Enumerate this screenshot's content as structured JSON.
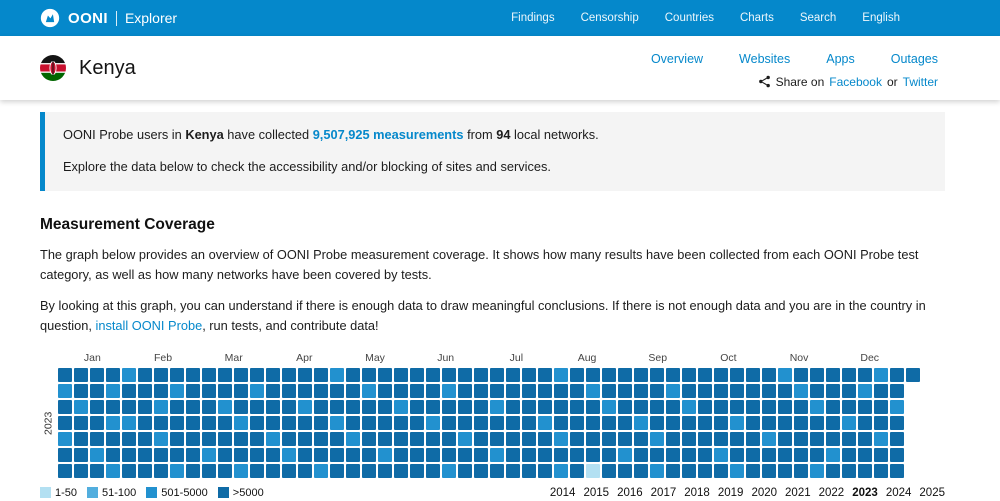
{
  "header": {
    "brand": "OONI",
    "brand_suffix": "Explorer",
    "nav": [
      "Findings",
      "Censorship",
      "Countries",
      "Charts",
      "Search",
      "English"
    ]
  },
  "country": {
    "name": "Kenya",
    "tabs": [
      "Overview",
      "Websites",
      "Apps",
      "Outages"
    ],
    "share_prefix": "Share on ",
    "share_facebook": "Facebook",
    "share_or": " or ",
    "share_twitter": "Twitter"
  },
  "info": {
    "p1a": "OONI Probe users in ",
    "p1_country": "Kenya",
    "p1b": " have collected ",
    "p1_link": "9,507,925 measurements",
    "p1c": " from ",
    "p1_count": "94",
    "p1d": " local networks.",
    "p2": "Explore the data below to check the accessibility and/or blocking of sites and services."
  },
  "coverage": {
    "title": "Measurement Coverage",
    "para1": "The graph below provides an overview of OONI Probe measurement coverage. It shows how many results have been collected from each OONI Probe test category, as well as how many networks have been covered by tests.",
    "para2a": "By looking at this graph, you can understand if there is enough data to draw meaningful conclusions. If there is not enough data and you are in the country in question, ",
    "para2_link": "install OONI Probe",
    "para2b": ", run tests, and contribute data!"
  },
  "chart_data": {
    "type": "heatmap",
    "title": "OONI Probe measurement coverage by week, Kenya",
    "year_label": "2023",
    "months": [
      "Jan",
      "Feb",
      "Mar",
      "Apr",
      "May",
      "Jun",
      "Jul",
      "Aug",
      "Sep",
      "Oct",
      "Nov",
      "Dec"
    ],
    "palette": [
      "#b3e0f2",
      "#52aede",
      "#2291cf",
      "#0f6ba6"
    ],
    "legend": [
      {
        "label": "1-50",
        "color": "#b3e0f2"
      },
      {
        "label": "51-100",
        "color": "#52aede"
      },
      {
        "label": "501-5000",
        "color": "#2291cf"
      },
      {
        "label": ">5000",
        "color": "#0f6ba6"
      }
    ],
    "years": [
      "2014",
      "2015",
      "2016",
      "2017",
      "2018",
      "2019",
      "2020",
      "2021",
      "2022",
      "2023",
      "2024",
      "2025"
    ],
    "active_year": "2023",
    "grid": [
      "333323333333333332333333333333323333333333333233333233",
      "23323332333323333332333323333333323333233333332333233",
      "32333323332333323333323333323333332333323333333233332",
      "33322333333233333233333233333323333323333323333332333",
      "23333323333332333323333332333332333332333333233333323",
      "33233333323333233333233333323333333233333233333323333",
      "33323332333233332333333323333332303332333323333233333"
    ]
  }
}
